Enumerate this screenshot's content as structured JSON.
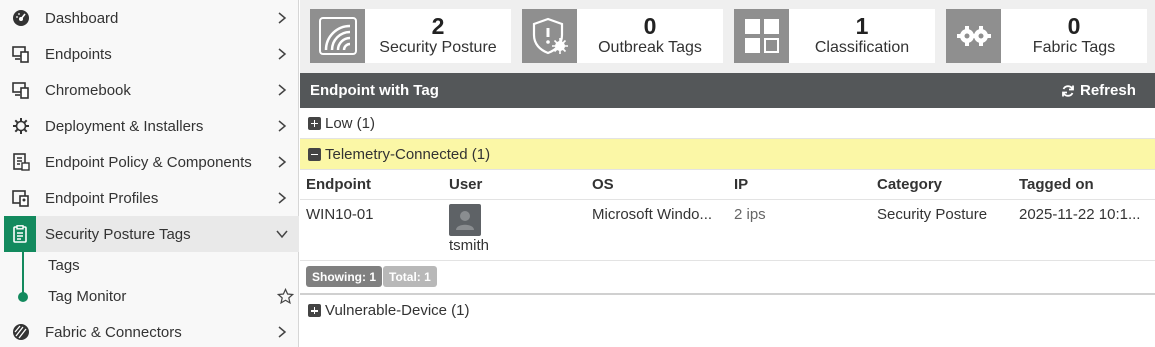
{
  "sidebar": {
    "items": [
      {
        "label": "Dashboard",
        "icon": "dashboard-icon"
      },
      {
        "label": "Endpoints",
        "icon": "endpoints-icon"
      },
      {
        "label": "Chromebook",
        "icon": "chromebook-icon"
      },
      {
        "label": "Deployment & Installers",
        "icon": "gear-icon"
      },
      {
        "label": "Endpoint Policy & Components",
        "icon": "policy-icon"
      },
      {
        "label": "Endpoint Profiles",
        "icon": "profiles-icon"
      },
      {
        "label": "Security Posture Tags",
        "icon": "tag-clipboard-icon"
      },
      {
        "label": "Fabric & Connectors",
        "icon": "fabric-icon"
      }
    ],
    "sub_items": [
      "Tags",
      "Tag Monitor"
    ],
    "accent": "#138a5e"
  },
  "cards": [
    {
      "value": "2",
      "label": "Security Posture"
    },
    {
      "value": "0",
      "label": "Outbreak Tags"
    },
    {
      "value": "1",
      "label": "Classification"
    },
    {
      "value": "0",
      "label": "Fabric Tags"
    }
  ],
  "panel": {
    "title": "Endpoint with Tag",
    "refresh_label": "Refresh",
    "groups": [
      {
        "label": "Low (1)",
        "expanded": false
      },
      {
        "label": "Telemetry-Connected (1)",
        "expanded": true
      },
      {
        "label": "Vulnerable-Device (1)",
        "expanded": false
      }
    ],
    "columns": [
      "Endpoint",
      "User",
      "OS",
      "IP",
      "Category",
      "Tagged on"
    ],
    "rows": [
      {
        "endpoint": "WIN10-01",
        "user": "tsmith",
        "os": "Microsoft Windo...",
        "ip": "2 ips",
        "category": "Security Posture",
        "tagged_on": "2025-11-22 10:1..."
      }
    ],
    "showing": "Showing: 1",
    "total": "Total: 1"
  }
}
